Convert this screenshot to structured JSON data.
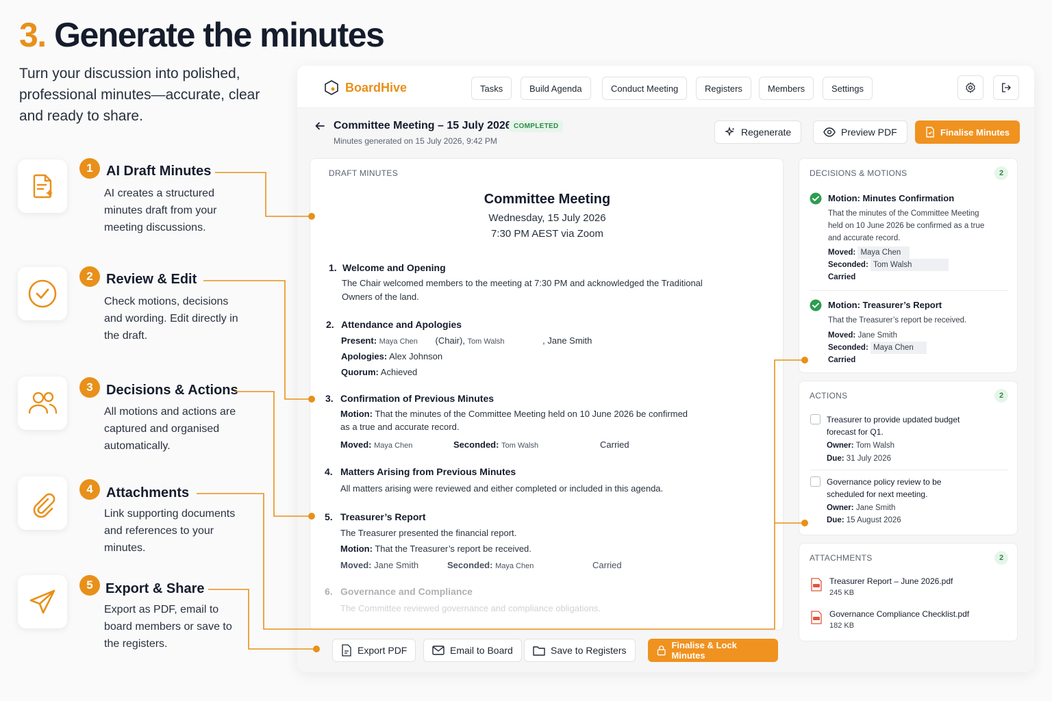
{
  "hero": {
    "number": "3.",
    "title": "Generate the minutes",
    "subtitle": "Turn your discussion into polished, professional minutes—accurate, clear and ready to share."
  },
  "steps": [
    {
      "num": "1",
      "title": "AI Draft Minutes",
      "desc": "AI creates a structured minutes draft from your meeting discussions.",
      "icon": "document-sparkle-icon"
    },
    {
      "num": "2",
      "title": "Review & Edit",
      "desc": "Check motions, decisions and wording. Edit directly in the draft.",
      "icon": "check-circle-icon"
    },
    {
      "num": "3",
      "title": "Decisions & Actions",
      "desc": "All motions and actions are captured and organised automatically.",
      "icon": "users-icon"
    },
    {
      "num": "4",
      "title": "Attachments",
      "desc": "Link supporting documents and references to your minutes.",
      "icon": "paperclip-icon"
    },
    {
      "num": "5",
      "title": "Export & Share",
      "desc": "Export as PDF, email to board members or save to the registers.",
      "icon": "send-icon"
    }
  ],
  "app": {
    "brand": "BoardHive",
    "nav": [
      "Tasks",
      "Build Agenda",
      "Conduct Meeting",
      "Registers",
      "Members",
      "Settings"
    ],
    "meeting_title": "Committee Meeting – 15 July 2026",
    "status": "COMPLETED",
    "generated": "Minutes generated on 15 July 2026, 9:42 PM",
    "actions": {
      "regenerate": "Regenerate",
      "preview": "Preview PDF",
      "finalise": "Finalise Minutes"
    },
    "accent": "#f0921f"
  },
  "draft": {
    "label": "DRAFT MINUTES",
    "title": "Committee Meeting",
    "date": "Wednesday, 15 July 2026",
    "time": "7:30 PM AEST via Zoom",
    "items": [
      {
        "num": "1.",
        "title": "Welcome and Opening",
        "text1": "The Chair welcomed members to the meeting at 7:30 PM and acknowledged the Traditional",
        "text2": "Owners of the land."
      },
      {
        "num": "2.",
        "title": "Attendance and Apologies",
        "present_label": "Present:",
        "present_1": "Maya Chen",
        "present_chair": "(Chair),",
        "present_2": "Tom Walsh",
        "present_3": ", Jane Smith",
        "apologies_label": "Apologies:",
        "apologies": "Alex Johnson",
        "quorum_label": "Quorum:",
        "quorum": "Achieved"
      },
      {
        "num": "3.",
        "title": "Confirmation of Previous Minutes",
        "motion_label": "Motion:",
        "motion1": "That the minutes of the Committee Meeting held on 10 June 2026 be confirmed",
        "motion2": "as a true and accurate record.",
        "moved_label": "Moved:",
        "moved": "Maya Chen",
        "seconded_label": "Seconded:",
        "seconded": "Tom Walsh",
        "result": "Carried"
      },
      {
        "num": "4.",
        "title": "Matters Arising from Previous Minutes",
        "text1": "All matters arising were reviewed and either completed or included in this agenda."
      },
      {
        "num": "5.",
        "title": "Treasurer’s Report",
        "text1": "The Treasurer presented the financial report.",
        "motion_label": "Motion:",
        "motion1": "That the Treasurer’s report be received.",
        "moved_label": "Moved:",
        "moved": "Jane Smith",
        "seconded_label": "Seconded:",
        "seconded": "Maya Chen",
        "result": "Carried"
      },
      {
        "num": "6.",
        "title": "Governance and Compliance",
        "text1": "The Committee reviewed governance and compliance obligations."
      }
    ]
  },
  "decisions": {
    "label": "DECISIONS & MOTIONS",
    "count": "2",
    "items": [
      {
        "title": "Motion: Minutes Confirmation",
        "desc1": "That the minutes of the Committee Meeting",
        "desc2": "held on 10 June 2026 be confirmed as a true",
        "desc3": "and accurate record.",
        "moved_label": "Moved:",
        "moved": "Maya Chen",
        "seconded_label": "Seconded:",
        "seconded": "Tom Walsh",
        "result": "Carried"
      },
      {
        "title": "Motion: Treasurer’s Report",
        "desc1": "That the Treasurer’s report be received.",
        "moved_label": "Moved:",
        "moved": "Jane Smith",
        "seconded_label": "Seconded:",
        "seconded": "Maya Chen",
        "result": "Carried"
      }
    ]
  },
  "actions_panel": {
    "label": "ACTIONS",
    "count": "2",
    "items": [
      {
        "title1": "Treasurer to provide updated budget",
        "title2": "forecast for Q1.",
        "owner_label": "Owner:",
        "owner": "Tom Walsh",
        "due_label": "Due:",
        "due": "31 July 2026"
      },
      {
        "title1": "Governance policy review to be",
        "title2": "scheduled for next meeting.",
        "owner_label": "Owner:",
        "owner": "Jane Smith",
        "due_label": "Due:",
        "due": "15 August 2026"
      }
    ]
  },
  "attachments": {
    "label": "ATTACHMENTS",
    "count": "2",
    "items": [
      {
        "name": "Treasurer Report – June 2026.pdf",
        "size": "245 KB"
      },
      {
        "name": "Governance Compliance Checklist.pdf",
        "size": "182 KB"
      }
    ]
  },
  "bottom": {
    "export": "Export PDF",
    "email": "Email to Board",
    "save": "Save to Registers",
    "finalise": "Finalise & Lock Minutes"
  }
}
